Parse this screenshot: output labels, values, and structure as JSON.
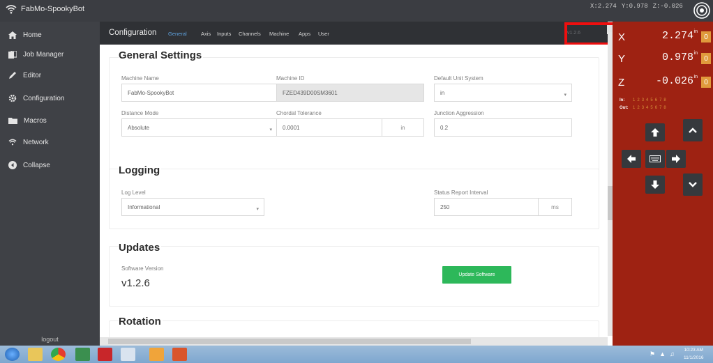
{
  "app": {
    "title": "FabMo-SpookyBot"
  },
  "position_readout": {
    "x": "X:2.274",
    "y": "Y:0.978",
    "z": "Z:-0.026"
  },
  "sidebar": {
    "items": [
      {
        "label": "Home",
        "icon": "home-icon"
      },
      {
        "label": "Job Manager",
        "icon": "job-manager-icon"
      },
      {
        "label": "Editor",
        "icon": "pencil-icon"
      },
      {
        "label": "Configuration",
        "icon": "gear-icon"
      },
      {
        "label": "Macros",
        "icon": "folder-icon"
      },
      {
        "label": "Network",
        "icon": "wifi-icon"
      },
      {
        "label": "Collapse",
        "icon": "collapse-icon"
      }
    ],
    "logout": "logout"
  },
  "tabbar": {
    "title": "Configuration",
    "tabs": [
      "General",
      "Axis",
      "Inputs",
      "Channels",
      "Machine",
      "Apps",
      "User"
    ],
    "active_tab": "General",
    "version_tag": "v1.2.6"
  },
  "general": {
    "title": "General Settings",
    "machine_name_label": "Machine Name",
    "machine_name_value": "FabMo-SpookyBot",
    "machine_id_label": "Machine ID",
    "machine_id_value": "FZED439D00SM3601",
    "unit_system_label": "Default Unit System",
    "unit_system_value": "in",
    "distance_mode_label": "Distance Mode",
    "distance_mode_value": "Absolute",
    "chordal_label": "Chordal Tolerance",
    "chordal_value": "0.0001",
    "chordal_unit": "in",
    "junction_label": "Junction Aggression",
    "junction_value": "0.2"
  },
  "logging": {
    "title": "Logging",
    "log_level_label": "Log Level",
    "log_level_value": "Informational",
    "status_interval_label": "Status Report Interval",
    "status_interval_value": "250",
    "status_interval_unit": "ms"
  },
  "updates": {
    "title": "Updates",
    "software_version_label": "Software Version",
    "software_version_value": "v1.2.6",
    "update_button": "Update Software"
  },
  "rotation": {
    "title": "Rotation"
  },
  "dro": {
    "axes": [
      {
        "letter": "X",
        "value": "2.274",
        "unit": "in",
        "zero": "0"
      },
      {
        "letter": "Y",
        "value": "0.978",
        "unit": "in",
        "zero": "0"
      },
      {
        "letter": "Z",
        "value": "-0.026",
        "unit": "in",
        "zero": "0"
      }
    ],
    "inputs_label": "In:",
    "outputs_label": "Out:",
    "io_numbers": [
      "1",
      "2",
      "3",
      "4",
      "5",
      "6",
      "7",
      "8"
    ]
  },
  "taskbar": {
    "time": "10:23 AM",
    "date": "11/1/2016"
  },
  "colors": {
    "sidebar": "#3f4146",
    "dro_panel": "#9e2212",
    "zero_button": "#e09a3c",
    "update_button": "#2db85a",
    "active_tab": "#5fa3e0",
    "annotation_box": "#ee0f0f"
  }
}
